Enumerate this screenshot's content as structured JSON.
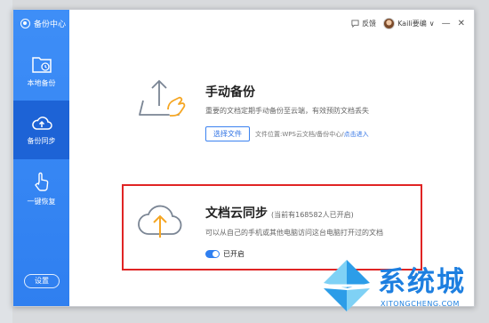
{
  "app": {
    "title": "备份中心"
  },
  "sidebar": {
    "items": [
      {
        "label": "本地备份",
        "icon": "folder-clock-icon"
      },
      {
        "label": "备份同步",
        "icon": "cloud-upload-icon"
      },
      {
        "label": "一键恢复",
        "icon": "hand-pointer-icon"
      }
    ],
    "settings_label": "设置"
  },
  "topbar": {
    "feedback_label": "反馈",
    "user_name": "Kaili要编",
    "dropdown_glyph": "∨",
    "minimize_glyph": "—",
    "close_glyph": "✕"
  },
  "manual_backup": {
    "title": "手动备份",
    "description": "重要的文档定期手动备份至云端，有效预防文档丢失",
    "select_button": "选择文件",
    "location_prefix": "文件位置:WPS云文档/备份中心/",
    "location_link": "点击进入"
  },
  "cloud_sync": {
    "title": "文档云同步",
    "user_count_note": "(当前有168582人已开启)",
    "description": "可以从自己的手机或其他电脑访问这台电脑打开过的文档",
    "toggle_label": "已开启",
    "toggle_on": true
  },
  "watermark": {
    "text": "系统城",
    "url": "XITONGCHENG.COM"
  },
  "colors": {
    "sidebar_blue": "#2f7ff0",
    "sidebar_active": "#1d63d6",
    "link_blue": "#2f72e4",
    "highlight_red": "#e02424",
    "accent_orange": "#f5a623"
  }
}
